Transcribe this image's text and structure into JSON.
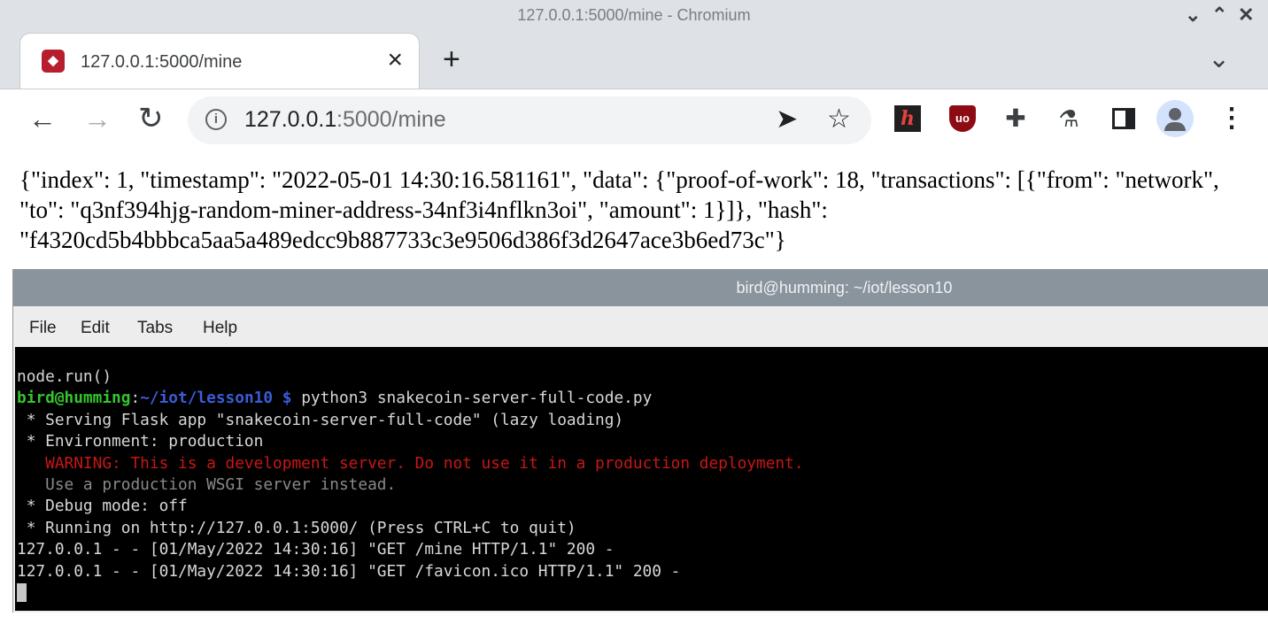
{
  "window": {
    "title": "127.0.0.1:5000/mine - Chromium",
    "controls": {
      "minimize": "⌄",
      "maximize": "⌃",
      "close": "✕"
    }
  },
  "tabs": [
    {
      "title": "127.0.0.1:5000/mine",
      "favicon": "diamond-favicon"
    }
  ],
  "tabstrip": {
    "new_tab": "+",
    "tab_search": "⌄"
  },
  "toolbar": {
    "url_host": "127.0.0.1",
    "url_rest": ":5000/mine",
    "icons": [
      "back-icon",
      "forward-icon",
      "reload-icon",
      "info-icon",
      "send-icon",
      "star-icon",
      "h-extension-icon",
      "ublock-icon",
      "puzzle-icon",
      "flask-icon",
      "side-panel-icon",
      "profile-icon",
      "menu-icon"
    ]
  },
  "page": {
    "json_text": "{\"index\": 1, \"timestamp\": \"2022-05-01 14:30:16.581161\", \"data\": {\"proof-of-work\": 18, \"transactions\": [{\"from\": \"network\", \"to\": \"q3nf394hjg-random-miner-address-34nf3i4nflkn3oi\", \"amount\": 1}]}, \"hash\": \"f4320cd5b4bbbca5aa5a489edcc9b887733c3e9506d386f3d2647ace3b6ed73c\"}"
  },
  "terminal": {
    "title": "bird@humming: ~/iot/lesson10",
    "menu": [
      "File",
      "Edit",
      "Tabs",
      "Help"
    ],
    "lines": {
      "l1": "node.run()",
      "prompt_user": "bird@humming",
      "prompt_sep": ":",
      "prompt_path": "~/iot/lesson10 $",
      "prompt_cmd": " python3 snakecoin-server-full-code.py",
      "l3": " * Serving Flask app \"snakecoin-server-full-code\" (lazy loading)",
      "l4": " * Environment: production",
      "l5": "   WARNING: This is a development server. Do not use it in a production deployment.",
      "l6": "   Use a production WSGI server instead.",
      "l7": " * Debug mode: off",
      "l8": " * Running on http://127.0.0.1:5000/ (Press CTRL+C to quit)",
      "l9": "127.0.0.1 - - [01/May/2022 14:30:16] \"GET /mine HTTP/1.1\" 200 -",
      "l10": "127.0.0.1 - - [01/May/2022 14:30:16] \"GET /favicon.ico HTTP/1.1\" 200 -"
    }
  },
  "colors": {
    "chrome_frame": "#dee1e6",
    "terminal_bg": "#000000",
    "prompt_user": "#36c42e",
    "prompt_path": "#3b5cd9",
    "warning": "#c81616"
  }
}
